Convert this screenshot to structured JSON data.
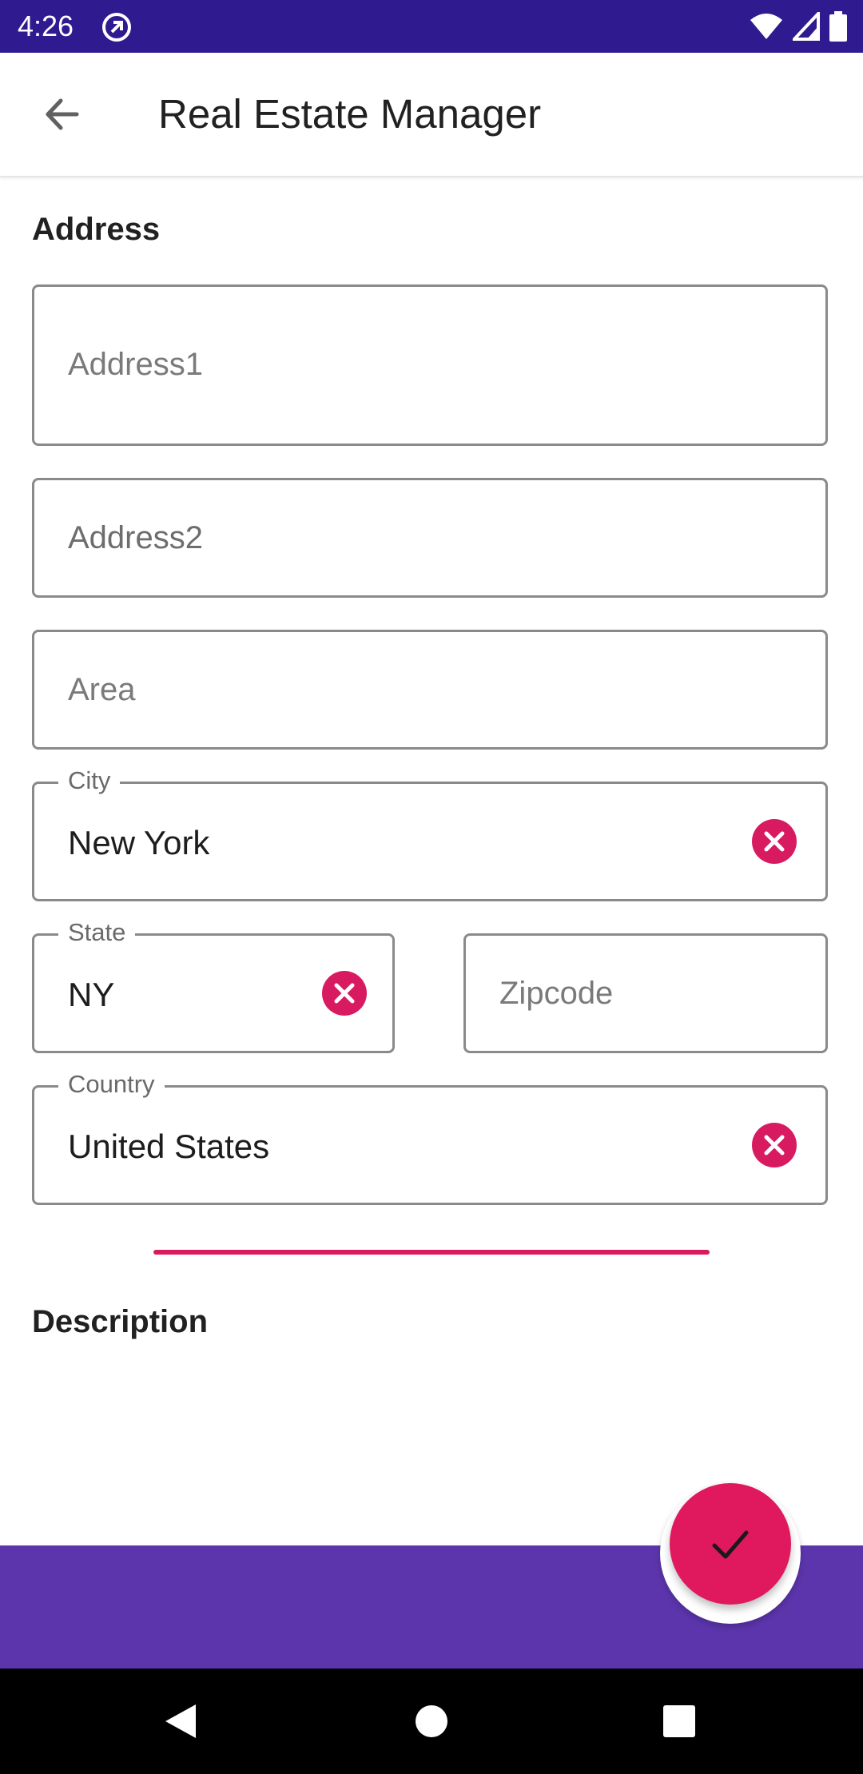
{
  "status_bar": {
    "time": "4:26",
    "icons": [
      "app-notification-icon",
      "wifi-icon",
      "signal-icon",
      "battery-icon"
    ]
  },
  "app_bar": {
    "title": "Real Estate Manager",
    "back_icon": "arrow-back-icon"
  },
  "address": {
    "heading": "Address",
    "address1_placeholder": "Address1",
    "address2_placeholder": "Address2",
    "area_placeholder": "Area",
    "city_label": "City",
    "city_value": "New York",
    "state_label": "State",
    "state_value": "NY",
    "zipcode_placeholder": "Zipcode",
    "country_label": "Country",
    "country_value": "United States"
  },
  "description": {
    "heading": "Description"
  },
  "fab": {
    "icon": "check-icon"
  },
  "nav_bar": {
    "icons": [
      "back-triangle-icon",
      "home-circle-icon",
      "recents-square-icon"
    ]
  },
  "colors": {
    "status_bar": "#2f1a8f",
    "bottom_bar": "#5c35ac",
    "accent": "#d81b60",
    "outline": "#8a8a8a"
  }
}
